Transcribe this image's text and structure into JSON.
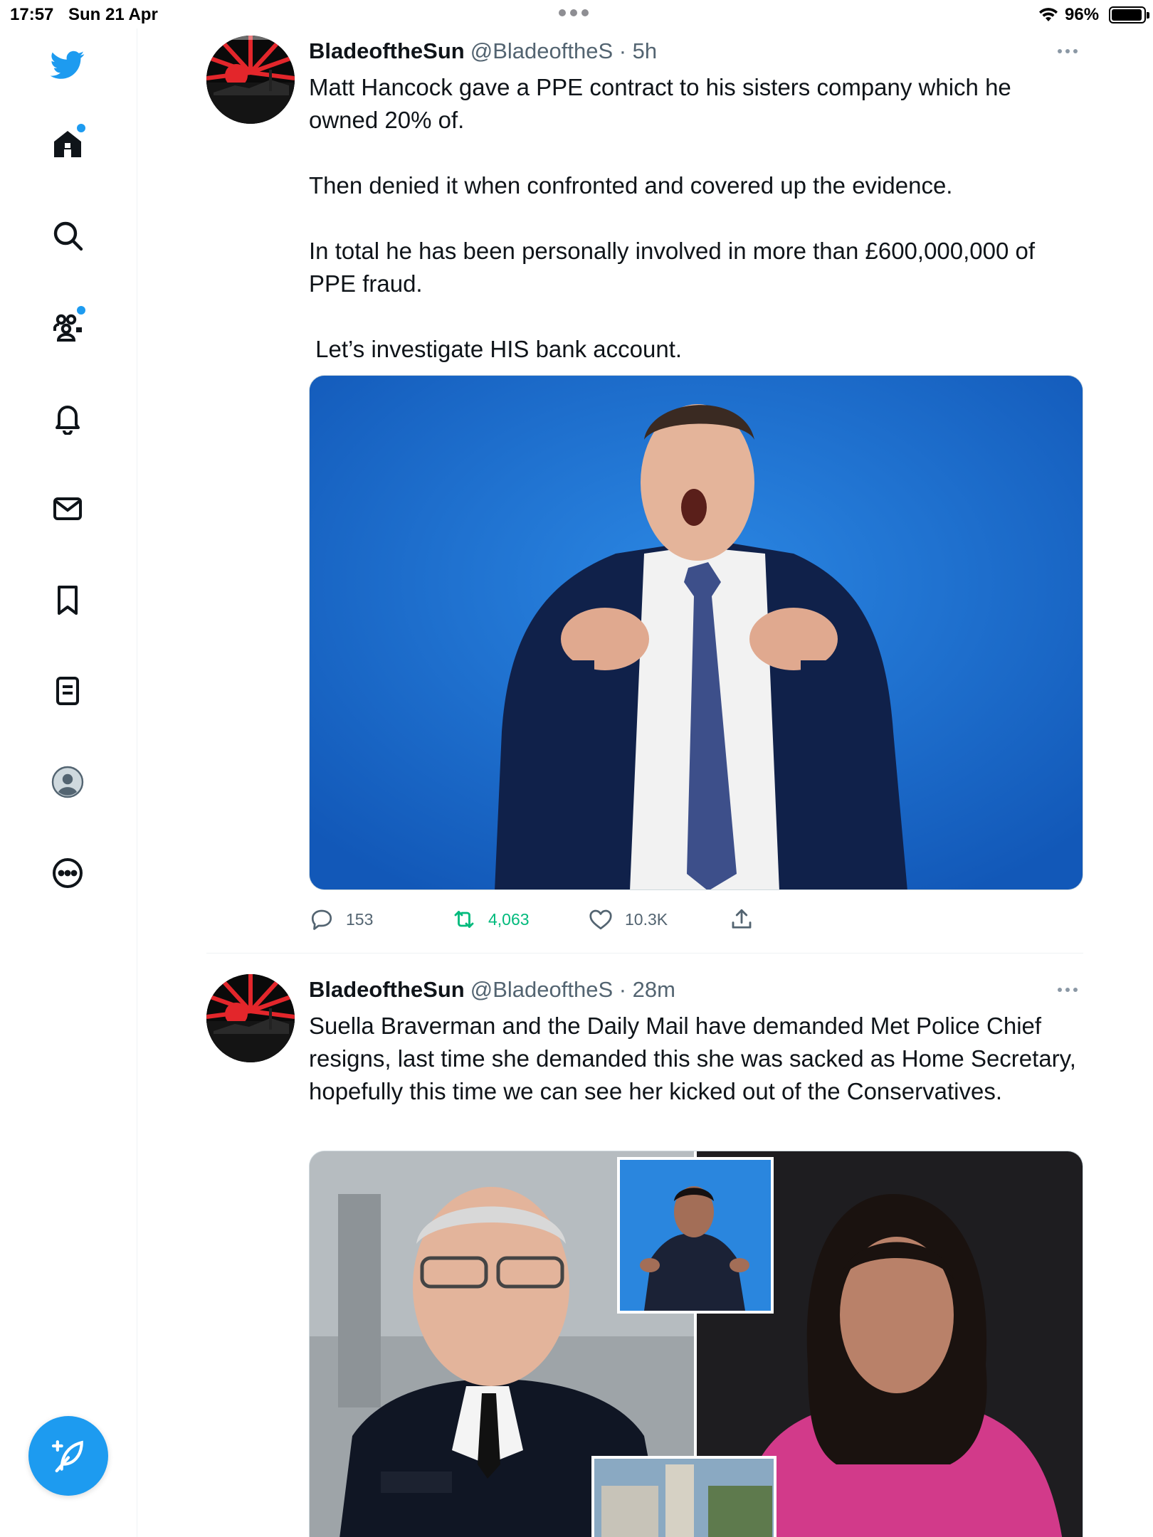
{
  "status_bar": {
    "time": "17:57",
    "date": "Sun 21 Apr",
    "battery": "96%",
    "battery_level": 0.96
  },
  "sidebar": {
    "items": [
      {
        "name": "twitter-logo",
        "icon": "bird-icon"
      },
      {
        "name": "home",
        "icon": "home-icon",
        "has_badge": true
      },
      {
        "name": "explore",
        "icon": "search-icon"
      },
      {
        "name": "communities",
        "icon": "communities-icon",
        "has_badge": true
      },
      {
        "name": "notifications",
        "icon": "bell-icon"
      },
      {
        "name": "messages",
        "icon": "mail-icon"
      },
      {
        "name": "bookmarks",
        "icon": "bookmark-icon"
      },
      {
        "name": "lists",
        "icon": "list-icon"
      },
      {
        "name": "profile",
        "icon": "avatar-icon"
      },
      {
        "name": "more",
        "icon": "more-circle-icon"
      }
    ],
    "compose_icon": "compose-feather-icon"
  },
  "tweets": [
    {
      "name": "BladeoftheSun",
      "handle": "@BladeoftheS · 5h",
      "paragraphs": [
        "Matt Hancock gave a PPE contract to his sisters company which he owned 20% of.",
        "Then denied it when confronted and covered up the evidence.",
        "In total he has been personally involved in more than £600,000,000 of PPE fraud.",
        " Let’s investigate HIS bank account."
      ],
      "replies": "153",
      "retweets": "4,063",
      "likes": "10.3K"
    },
    {
      "name": "BladeoftheSun",
      "handle": "@BladeoftheS · 28m",
      "paragraphs": [
        "Suella Braverman and the Daily Mail have demanded Met Police Chief resigns, last time she demanded this she was sacked as Home Secretary, hopefully this time we can see her kicked out of the Conservatives."
      ]
    }
  ],
  "colors": {
    "accent": "#1d9bf0",
    "retweet": "#00ba7c",
    "muted": "#536471"
  }
}
